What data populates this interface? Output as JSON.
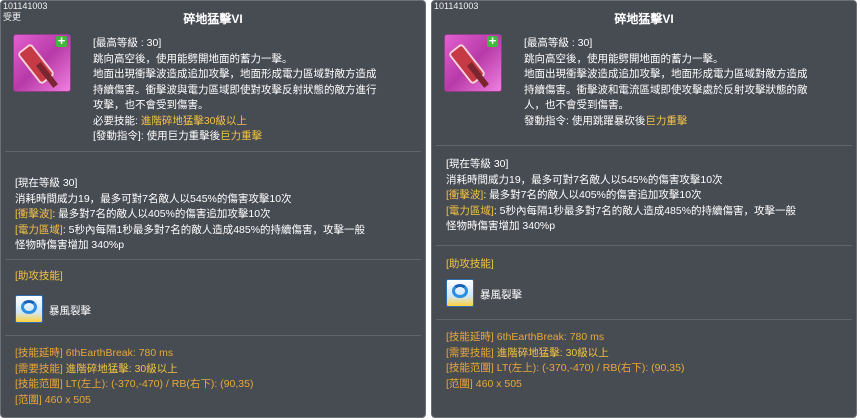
{
  "left": {
    "code": "101141003",
    "tag": "受更",
    "title": "碎地猛擊VI",
    "desc": [
      [
        {
          "t": "[最高等級 : 30]"
        }
      ],
      [
        {
          "t": "跳向高空後，使用能劈開地面的蓄力一擊。"
        }
      ],
      [
        {
          "t": "地面出現衝擊波造成追加攻擊，地面形成電力區域對敵方造成"
        }
      ],
      [
        {
          "t": "持續傷害。衝擊波與電力區域即使對攻擊反射狀態的敵方進行"
        }
      ],
      [
        {
          "t": "攻擊，也不會受到傷害。"
        }
      ],
      [
        {
          "t": "必要技能: "
        },
        {
          "t": "進階碎地猛擊30級以上",
          "c": "gold"
        }
      ],
      [
        {
          "t": "[發動指令]: 使用巨力重擊後"
        },
        {
          "t": "巨力重擊",
          "c": "gold"
        }
      ]
    ],
    "level": [
      [
        {
          "t": "[現在等級 30]"
        }
      ],
      [
        {
          "t": "消耗時間威力19，最多可對7名敵人以545%的傷害攻擊10次"
        }
      ],
      [
        {
          "t": "[衝擊波]",
          "c": "gold"
        },
        {
          "t": ": 最多對7名的敵人以405%的傷害追加攻擊10次"
        }
      ],
      [
        {
          "t": "[電力區域]",
          "c": "gold"
        },
        {
          "t": ": 5秒內每隔1秒最多對7名的敵人造成485%的持續傷害，攻擊一般"
        }
      ],
      [
        {
          "t": "怪物時傷害增加 340%p"
        }
      ]
    ],
    "assist_label": "[助攻技能]",
    "assist_skill": "暴風裂擊",
    "meta": [
      [
        {
          "t": "[技能延時]",
          "c": "orange"
        },
        {
          "t": " 6thEarthBreak: 780 ms",
          "c": "orange"
        }
      ],
      [
        {
          "t": "[需要技能]",
          "c": "orange"
        },
        {
          "t": " 進階碎地猛擊: 30級以上",
          "c": "gold"
        }
      ],
      [
        {
          "t": "[技能范圍]",
          "c": "orange"
        },
        {
          "t": " LT(左上): (-370,-470) / RB(右下): (90,35)",
          "c": "orange"
        }
      ],
      [
        {
          "t": "[范圍]",
          "c": "orange"
        },
        {
          "t": " 460 x 505",
          "c": "orange"
        }
      ]
    ]
  },
  "right": {
    "code": "101141003",
    "title": "碎地猛擊VI",
    "desc": [
      [
        {
          "t": "[最高等級 : 30]"
        }
      ],
      [
        {
          "t": "跳向高空後，使用能劈開地面的蓄力一擊。"
        }
      ],
      [
        {
          "t": "地面出現衝擊波造成追加攻擊，地面形成電力區域對敵方造成"
        }
      ],
      [
        {
          "t": "持續傷害。衝擊波和電流區域即使攻擊處於反射攻擊狀態的敵"
        }
      ],
      [
        {
          "t": "人，也不會受到傷害。"
        }
      ],
      [
        {
          "t": "發動指令: 使用跳躍暴砍後"
        },
        {
          "t": "巨力重擊",
          "c": "gold"
        }
      ]
    ],
    "level": [
      [
        {
          "t": "[現在等級 30]"
        }
      ],
      [
        {
          "t": "消耗時間威力19，最多可對7名敵人以545%的傷害攻擊10次"
        }
      ],
      [
        {
          "t": "[衝擊波]",
          "c": "gold"
        },
        {
          "t": ": 最多對7名的敵人以405%的傷害追加攻擊10次"
        }
      ],
      [
        {
          "t": "[電力區域]",
          "c": "gold"
        },
        {
          "t": ": 5秒內每隔1秒最多對7名的敵人造成485%的持續傷害，攻擊一般"
        }
      ],
      [
        {
          "t": "怪物時傷害增加 340%p"
        }
      ]
    ],
    "assist_label": "[助攻技能]",
    "assist_skill": "暴風裂擊",
    "meta": [
      [
        {
          "t": "[技能延時]",
          "c": "orange"
        },
        {
          "t": " 6thEarthBreak: 780 ms",
          "c": "orange"
        }
      ],
      [
        {
          "t": "[需要技能]",
          "c": "orange"
        },
        {
          "t": " 進階碎地猛擊: 30級以上",
          "c": "gold"
        }
      ],
      [
        {
          "t": "[技能范圍]",
          "c": "orange"
        },
        {
          "t": " LT(左上): (-370,-470) / RB(右下): (90,35)",
          "c": "orange"
        }
      ],
      [
        {
          "t": "[范圍]",
          "c": "orange"
        },
        {
          "t": " 460 x 505",
          "c": "orange"
        }
      ]
    ]
  }
}
